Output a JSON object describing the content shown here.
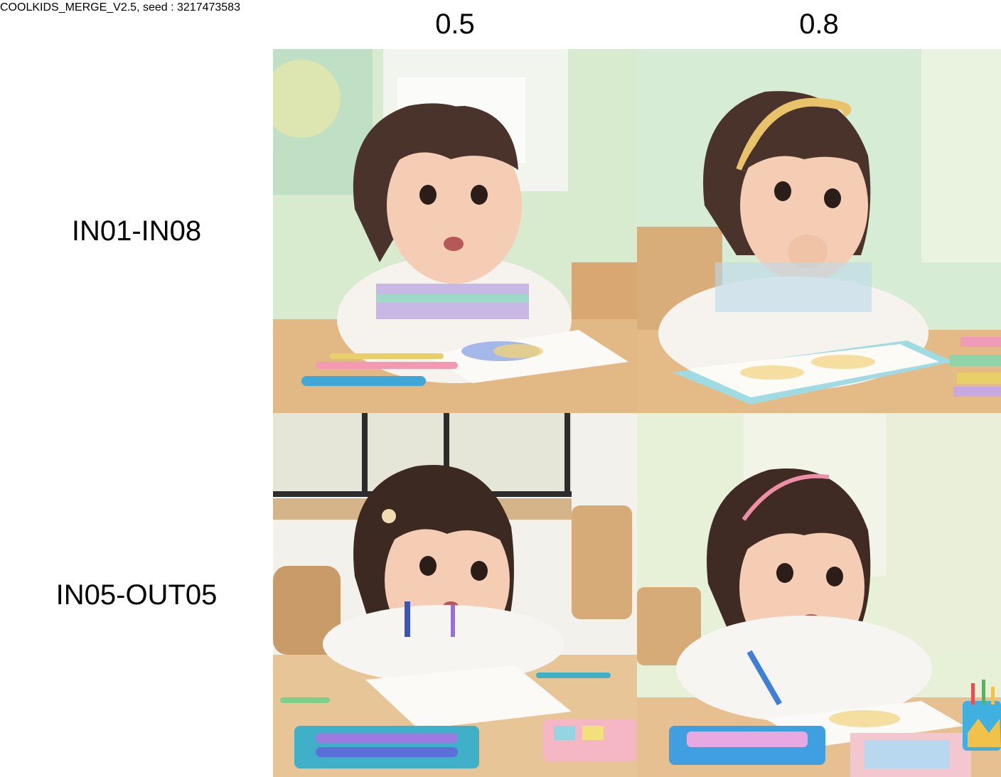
{
  "header": {
    "caption": "COOLKIDS_MERGE_V2.5, seed : 3217473583"
  },
  "grid": {
    "columns": [
      "0.5",
      "0.8"
    ],
    "rows": [
      "IN01-IN08",
      "IN05-OUT05"
    ]
  },
  "colors": {
    "background": "#ffffff",
    "text": "#000000"
  }
}
